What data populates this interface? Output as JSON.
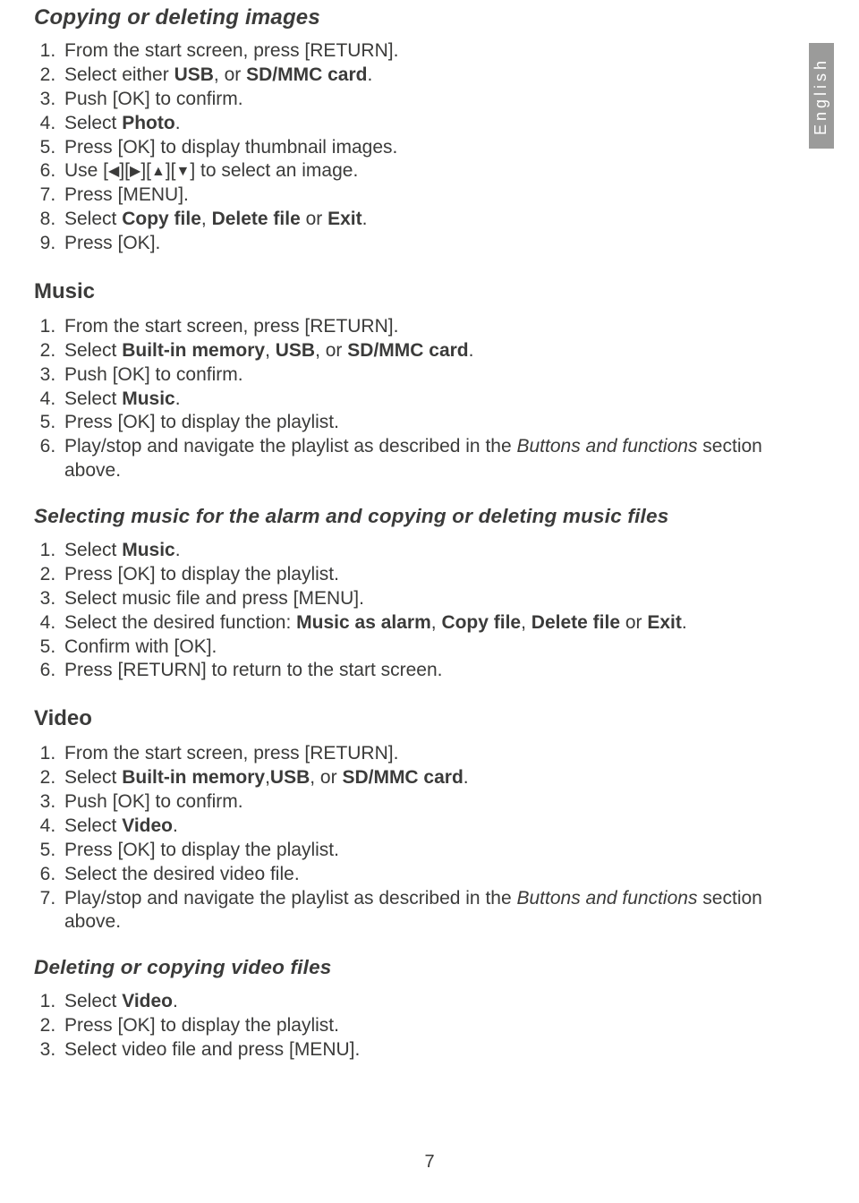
{
  "language_tab": "English",
  "page_number": "7",
  "h_copydel": "Copying or deleting images",
  "cd": {
    "s1a": "From the start screen, press [",
    "s1b": "RETURN",
    "s1c": "].",
    "s2a": "Select either ",
    "s2b": "USB",
    "s2c": ", or ",
    "s2d": "SD/MMC card",
    "s2e": ".",
    "s3a": "Push [OK",
    "s3b": "] to confirm.",
    "s4a": "Select ",
    "s4b": "Photo",
    "s4c": ".",
    "s5": "Press [OK] to display thumbnail images.",
    "s6a": "Use [",
    "s6b": "][",
    "s6c": "][",
    "s6d": "][",
    "s6e": "] to select an image.",
    "s7a": "Press [",
    "s7b": "MENU",
    "s7c": "].",
    "s8a": "Select ",
    "s8b": "Copy file",
    "s8c": ", ",
    "s8d": "Delete file",
    "s8e": " or ",
    "s8f": "Exit",
    "s8g": ".",
    "s9": "Press [OK]."
  },
  "h_music": "Music",
  "mu": {
    "s1a": "From the start screen, press [",
    "s1b": "RETURN",
    "s1c": "].",
    "s2a": "Select ",
    "s2b": "Built-in memory",
    "s2c": ", ",
    "s2d": "USB",
    "s2e": ", or ",
    "s2f": "SD/MMC card",
    "s2g": ".",
    "s3": "Push [OK] to confirm.",
    "s4a": "Select ",
    "s4b": "Music",
    "s4c": ".",
    "s5": "Press [OK] to display the playlist.",
    "s6a": "Play/stop and navigate the playlist as described in the ",
    "s6b": "Buttons and functions",
    "s6c": " section above."
  },
  "h_selmusic": "Selecting music for the alarm and copying or deleting music files",
  "sm": {
    "s1a": "Select ",
    "s1b": "Music",
    "s1c": ".",
    "s2": "Press [OK] to display the playlist.",
    "s3a": "Select music file and press [",
    "s3b": "MENU",
    "s3c": "].",
    "s4a": "Select the desired function: ",
    "s4b": "Music as alarm",
    "s4c": ", ",
    "s4d": "Copy file",
    "s4e": ", ",
    "s4f": "Delete file",
    "s4g": " or ",
    "s4h": "Exit",
    "s4i": ".",
    "s5": "Confirm with [OK].",
    "s6a": "Press [",
    "s6b": "RETURN",
    "s6c": "] to return to the start screen."
  },
  "h_video": "Video",
  "vi": {
    "s1a": "From the start screen, press [",
    "s1b": "RETURN",
    "s1c": "].",
    "s2a": "Select ",
    "s2b": "Built-in memory",
    "s2c": ",",
    "s2d": "USB",
    "s2e": ", or ",
    "s2f": "SD/MMC card",
    "s2g": ".",
    "s3": "Push [OK] to confirm.",
    "s4a": "Select ",
    "s4b": "Video",
    "s4c": ".",
    "s5": "Press [OK] to display the playlist.",
    "s6": "Select the desired video file.",
    "s7a": "Play/stop and navigate the playlist as described in the ",
    "s7b": "Buttons and functions",
    "s7c": " section above."
  },
  "h_delvid": "Deleting or copying video files",
  "dv": {
    "s1a": "Select ",
    "s1b": "Video",
    "s1c": ".",
    "s2": "Press [OK] to display the playlist.",
    "s3a": "Select video file and press [",
    "s3b": "MENU",
    "s3c": "]."
  }
}
